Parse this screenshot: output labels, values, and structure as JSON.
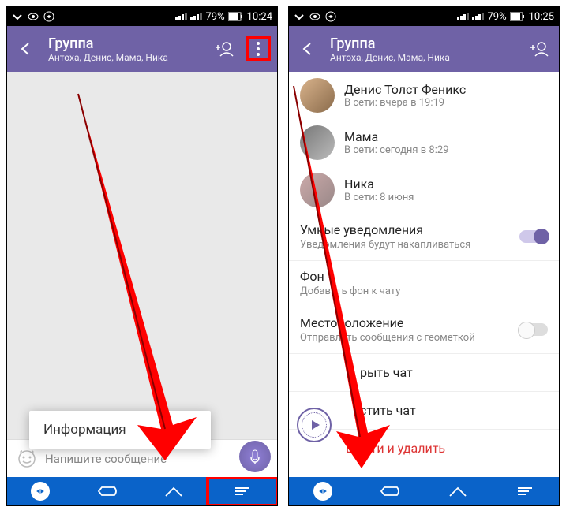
{
  "colors": {
    "accent": "#6f62a6",
    "nav": "#0a63c9",
    "highlight": "#ff0000",
    "danger": "#d33"
  },
  "screens": {
    "left": {
      "status": {
        "battery": "79%",
        "time": "10:24"
      },
      "header": {
        "title": "Группа",
        "subtitle": "Антоха, Денис, Мама, Ника"
      },
      "compose_placeholder": "Напишите сообщение",
      "popup_item": "Информация"
    },
    "right": {
      "status": {
        "battery": "79%",
        "time": "10:25"
      },
      "header": {
        "title": "Группа",
        "subtitle": "Антоха, Денис, Мама, Ника"
      },
      "members": [
        {
          "name": "Денис Толст Феникс",
          "status": "В сети: вчера в 19:19"
        },
        {
          "name": "Мама",
          "status": "В сети: сегодня в 8:29"
        },
        {
          "name": "Ника",
          "status": "В сети: 8 июня"
        }
      ],
      "settings": {
        "smart": {
          "title": "Умные уведомления",
          "desc": "Уведомления будут накапливаться",
          "on": true
        },
        "bg": {
          "title": "Фон",
          "desc": "Добавить фон к чату"
        },
        "loc": {
          "title": "Местоположение",
          "desc": "Отправлять сообщения с геометкой",
          "on": false
        }
      },
      "actions": {
        "hide": "рыть чат",
        "clear": "стить чат",
        "leave": "Выйти и удалить"
      }
    }
  }
}
